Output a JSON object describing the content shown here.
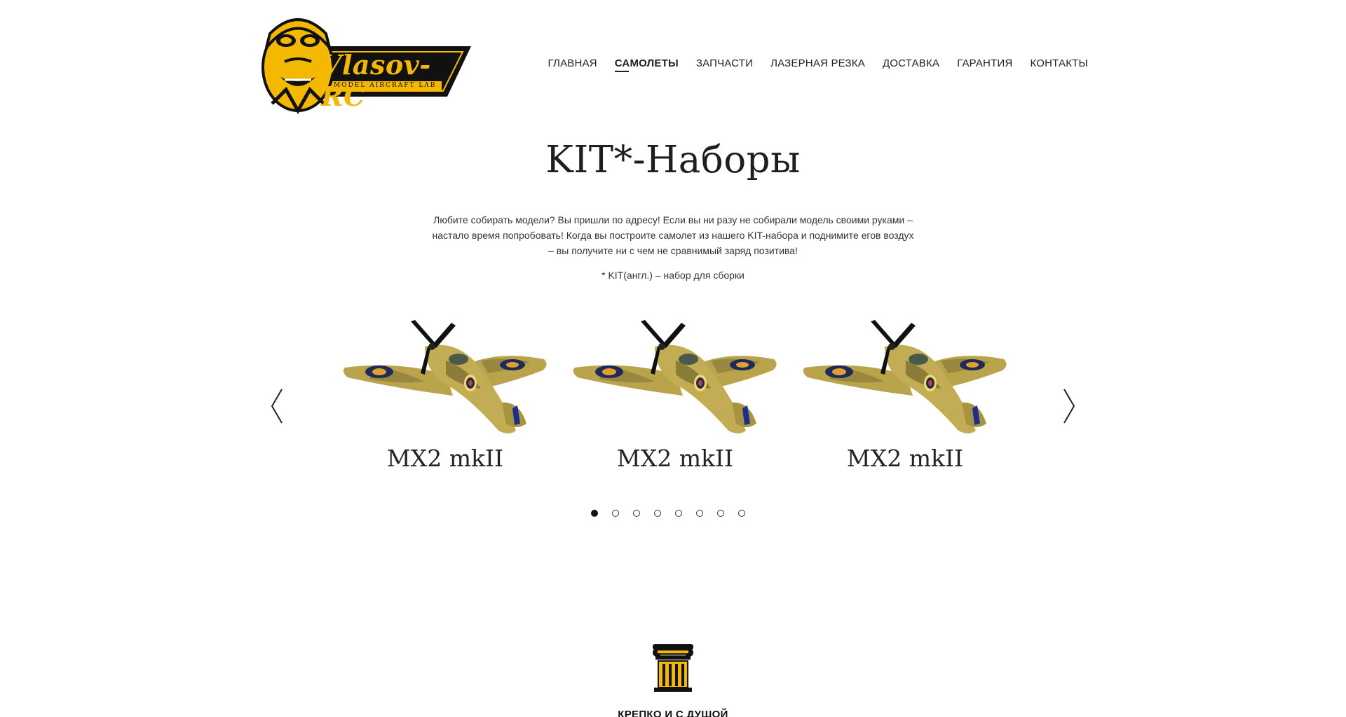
{
  "logo": {
    "text": "Vlasov-RC",
    "subtitle": "MODEL AIRCRAFT LAB",
    "color_accent": "#f5b800",
    "color_dark": "#111111"
  },
  "nav": {
    "items": [
      "ГЛАВНАЯ",
      "САМОЛЕТЫ",
      "ЗАПЧАСТИ",
      "ЛАЗЕРНАЯ РЕЗКА",
      "ДОСТАВКА",
      "ГАРАНТИЯ",
      "КОНТАКТЫ"
    ],
    "active": "САМОЛЕТЫ"
  },
  "main": {
    "title": "KIT*-Наборы",
    "intro": "Любите собирать модели? Вы пришли по адресу! Если вы ни разу не собирали модель своими руками – настало время попробовать! Когда вы построите самолет из нашего KIT-набора и поднимите егов воздух – вы получите ни с чем не сравнимый заряд позитива!",
    "note": "* KIT(англ.) – набор для сборки"
  },
  "carousel": {
    "cards": [
      {
        "title": "MX2 mkII",
        "image": "spitfire-model-image"
      },
      {
        "title": "MX2 mkII",
        "image": "spitfire-model-image"
      },
      {
        "title": "MX2 mkII",
        "image": "spitfire-model-image"
      }
    ],
    "prev_icon": "chevron-left-icon",
    "next_icon": "chevron-right-icon",
    "page_count": 8,
    "active_page": 1
  },
  "feature": {
    "icon": "column-icon",
    "title": "КРЕПКО И С ДУШОЙ"
  }
}
